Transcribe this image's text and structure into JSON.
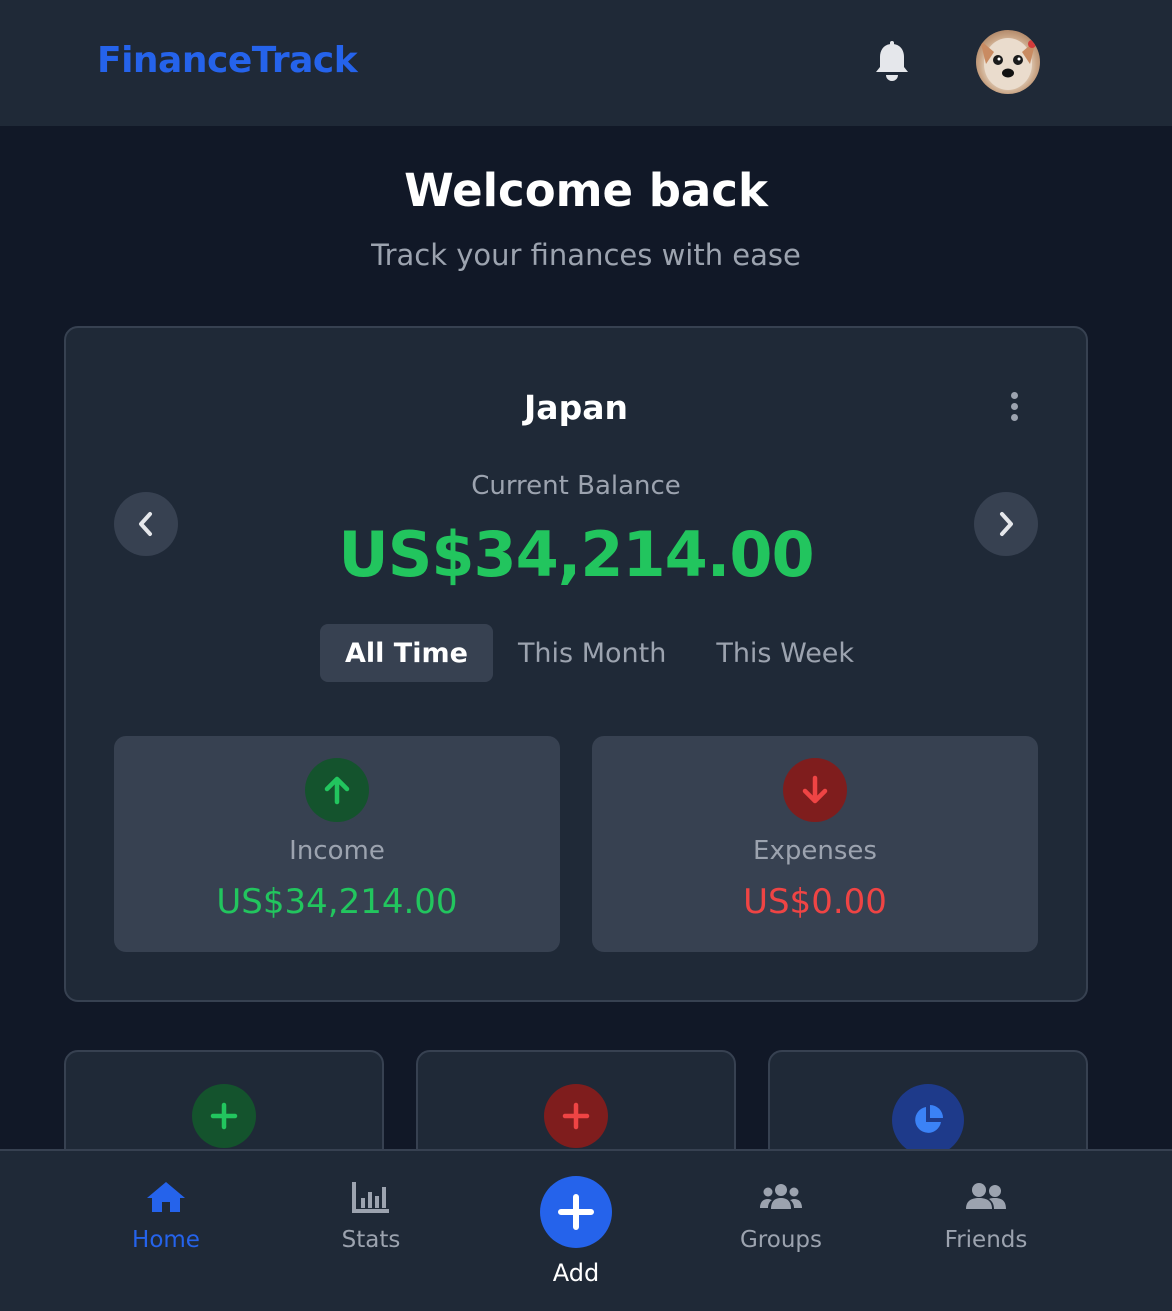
{
  "header": {
    "brand": "FinanceTrack",
    "notification_icon": "bell-icon",
    "avatar_icon": "user-avatar"
  },
  "welcome": {
    "title": "Welcome back",
    "subtitle": "Track your finances with ease"
  },
  "balance_card": {
    "title": "Japan",
    "label": "Current Balance",
    "amount": "US$34,214.00",
    "tabs": [
      {
        "label": "All Time",
        "active": true
      },
      {
        "label": "This Month",
        "active": false
      },
      {
        "label": "This Week",
        "active": false
      }
    ],
    "income": {
      "label": "Income",
      "value": "US$34,214.00"
    },
    "expenses": {
      "label": "Expenses",
      "value": "US$0.00"
    }
  },
  "quick_actions": [
    {
      "icon": "plus-icon",
      "color": "#22c55e"
    },
    {
      "icon": "plus-icon",
      "color": "#ef4444"
    },
    {
      "icon": "pie-chart-icon",
      "color": "#3b82f6"
    }
  ],
  "bottom_nav": {
    "home": "Home",
    "stats": "Stats",
    "add": "Add",
    "groups": "Groups",
    "friends": "Friends"
  },
  "colors": {
    "accent": "#2563eb",
    "income": "#22c55e",
    "expense": "#ef4444",
    "background": "#111827",
    "surface": "#1f2937"
  }
}
